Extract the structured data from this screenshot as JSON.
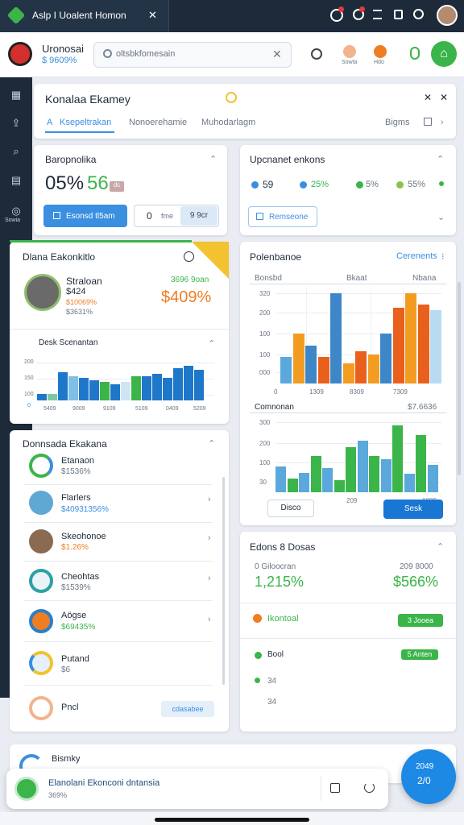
{
  "titlebar": {
    "tab_title": "Aslp I Uoalent Homon",
    "close": "✕"
  },
  "appbar": {
    "brand_name": "Uronosai",
    "brand_value": "$ 9609%",
    "search_placeholder": "oltsbkfomesain",
    "actions": [
      {
        "label": "Sowta"
      },
      {
        "label": "Hdo"
      }
    ]
  },
  "sidebar": {
    "bottom_label": "Sowia"
  },
  "panel": {
    "title": "Konalaa Ekamey",
    "tabs": [
      "Ksepeltrakan",
      "Nonoerehamie",
      "Muhodarlagm"
    ],
    "right_label": "Bigms"
  },
  "balance": {
    "title": "Baropnolika",
    "big_value": "05%",
    "small_value": "56",
    "badge": "dc",
    "button_label": "Esonsd tl5am",
    "field_value": "0",
    "field_hint": "fme",
    "field_badge": "9 9cr"
  },
  "upcoming": {
    "title": "Upcnanet enkons",
    "stats": [
      {
        "label": "59",
        "color": "#3b8fe0"
      },
      {
        "label": "25%",
        "color": "#3b8fe0"
      },
      {
        "label": "5%",
        "color": "#3bb54a"
      },
      {
        "label": "55%",
        "color": "#8bc34a"
      }
    ],
    "button_label": "Remseone"
  },
  "card_ek": {
    "title": "Dlana Eakonkitlo",
    "person_name": "Straloan",
    "person_value": "$424",
    "person_sub1": "$10069%",
    "person_sub2": "$3631%",
    "green_text": "3696 9oan",
    "big_percent": "$409%",
    "chart_title": "Desk Scenantan",
    "tick_labels": [
      "200",
      "150",
      "100",
      "0"
    ],
    "x_labels": [
      "5409",
      "9009",
      "9109",
      "5109",
      "0409",
      "5209"
    ]
  },
  "chart_data": [
    {
      "type": "bar",
      "title": "Desk Scenantan",
      "categories": [
        "5409",
        "9009",
        "9109",
        "5109",
        "0409",
        "5209"
      ],
      "series": [
        {
          "values": [
            15,
            15,
            70,
            60,
            55,
            50,
            45,
            40,
            45,
            60,
            60,
            65,
            55,
            80,
            85,
            75
          ]
        }
      ],
      "ylim": [
        0,
        200
      ]
    },
    {
      "type": "bar",
      "title": "Polenbanoe",
      "categories": [
        "0",
        "1309",
        "8309",
        "7309"
      ],
      "xlabel": "",
      "ylabel": "",
      "ylim": [
        0,
        320
      ],
      "series": [
        {
          "values": [
            90,
            170,
            130,
            90,
            310,
            70,
            110,
            100,
            170,
            260,
            310,
            270,
            250
          ]
        }
      ]
    },
    {
      "type": "bar",
      "title": "Comnonan",
      "series": [
        {
          "values": [
            85,
            45,
            65,
            120,
            80,
            40,
            150,
            170,
            120,
            110,
            220,
            60,
            190,
            90
          ]
        }
      ],
      "ylim": [
        0,
        300
      ]
    }
  ],
  "polen": {
    "title": "Polenbanoe",
    "right_label": "Cerenents",
    "col_labels": [
      "Bonsbd",
      "Bkaat",
      "Nbana"
    ],
    "tick_labels": [
      "320",
      "200",
      "100",
      "100",
      "000",
      "0"
    ],
    "x_labels": [
      "0",
      "1309",
      "8309",
      "7309"
    ],
    "comnonan_title": "Comnonan",
    "comnonan_value": "$7.6636",
    "tick_labels2": [
      "300",
      "200",
      "100",
      "30"
    ],
    "x_labels2": [
      "0",
      "209",
      "1000"
    ],
    "cancel_label": "Disco",
    "confirm_label": "Sesk"
  },
  "donors": {
    "title": "Donnsada Ekakana",
    "items": [
      {
        "name": "Etanaon",
        "value": "$1536%",
        "value_color": "#6b7785"
      },
      {
        "name": "Flarlers",
        "value": "$40931356%",
        "value_color": "#3b8fe0"
      },
      {
        "name": "Skeohonoe",
        "value": "$1.26%",
        "value_color": "#ef7d22"
      },
      {
        "name": "Cheohtas",
        "value": "$1539%",
        "value_color": "#6b7785"
      },
      {
        "name": "Aögse",
        "value": "$69435%",
        "value_color": "#3bb54a"
      },
      {
        "name": "Putand",
        "value": "$6",
        "value_color": "#6b7785"
      },
      {
        "name": "Pncl",
        "value": "",
        "value_color": "#6b7785"
      }
    ],
    "last_badge": "cdasabee"
  },
  "edens": {
    "title": "Edons 8 Dosas",
    "left_label": "0 Giloocran",
    "left_value": "1,215%",
    "right_label": "209 8000",
    "right_value": "$566%",
    "row_title": "Ikontoal",
    "row_badge": "3 Jooea",
    "rows": [
      {
        "label": "Bool",
        "badge": "5 Anten"
      },
      {
        "label": "34",
        "badge": ""
      },
      {
        "label": "34",
        "badge": ""
      }
    ]
  },
  "bottom": {
    "peek_title": "Bismky",
    "toast_title": "Elanolani Ekonconi dntansia",
    "toast_sub": "369%",
    "fab_line1": "2049",
    "fab_line2": "2/0"
  }
}
